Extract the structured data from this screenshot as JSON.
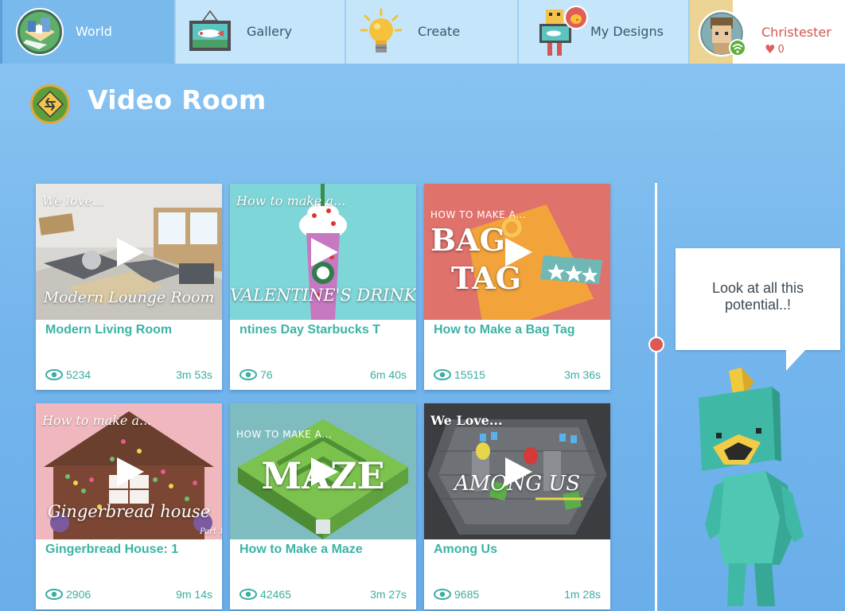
{
  "nav": {
    "tabs": [
      {
        "label": "World",
        "icon": "world-island-icon"
      },
      {
        "label": "Gallery",
        "icon": "gallery-painting-icon"
      },
      {
        "label": "Create",
        "icon": "lightbulb-icon"
      },
      {
        "label": "My Designs",
        "icon": "my-designs-icon"
      }
    ],
    "user": {
      "name": "Christester",
      "likes": "0",
      "icon": "user-avatar-icon"
    }
  },
  "page": {
    "title": "Video Room"
  },
  "videos": [
    {
      "title": "Modern Living Room",
      "views": "5234",
      "duration": "3m 53s",
      "overlay_small": "We love...",
      "overlay_big": "Modern Lounge Room"
    },
    {
      "title": "ntines Day Starbucks T",
      "views": "76",
      "duration": "6m 40s",
      "overlay_small": "How to make a...",
      "overlay_big": "VALENTINE'S DRINK"
    },
    {
      "title": "How to Make a Bag Tag",
      "views": "15515",
      "duration": "3m 36s",
      "overlay_caps": "HOW TO MAKE A...",
      "overlay_big_1": "BAG",
      "overlay_big_2": "TAG"
    },
    {
      "title": "Gingerbread House: 1",
      "views": "2906",
      "duration": "9m 14s",
      "overlay_small": "How to make a...",
      "overlay_big": "Gingerbread house",
      "overlay_part": "Part 1"
    },
    {
      "title": "How to Make a Maze",
      "views": "42465",
      "duration": "3m 27s",
      "overlay_caps": "HOW TO MAKE A...",
      "overlay_big": "MAZE"
    },
    {
      "title": "Among Us",
      "views": "9685",
      "duration": "1m 28s",
      "overlay_small": "We Love...",
      "overlay_big": "AMONG US"
    }
  ],
  "bubble": {
    "text": "Look at all this potential..!"
  },
  "colors": {
    "accent_teal": "#3bb3a6",
    "user_red": "#d4564f",
    "slider_thumb": "#dc5a55",
    "active_tab": "#79b9ec"
  }
}
